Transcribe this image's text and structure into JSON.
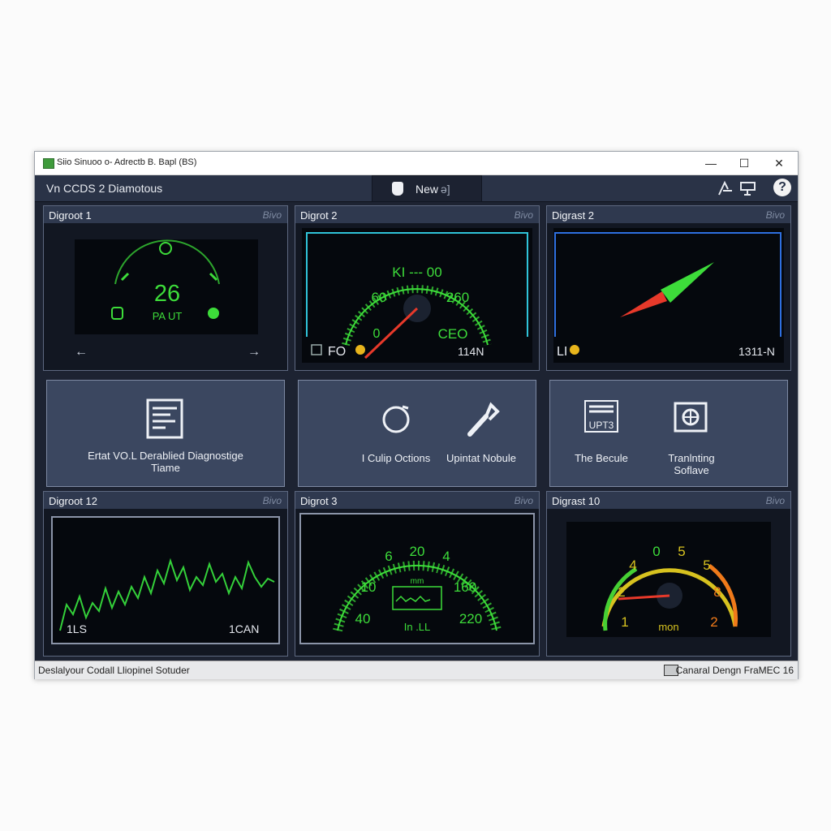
{
  "window": {
    "title": "Siio Sinuoo o- Adrectb B. Bapl (BS)",
    "controls": {
      "minimize": "—",
      "maximize": "☐",
      "close": "✕"
    }
  },
  "toolbar": {
    "app_name": "Vn CCDS 2 Diamotous",
    "new_label": "New",
    "new_suffix": "ə]",
    "help_label": "?"
  },
  "panels": [
    {
      "title": "Digroot 1",
      "tag": "Bivo",
      "readout": "26",
      "mode": "PA UT",
      "left_nav": "←",
      "right_nav": "→"
    },
    {
      "title": "Digrot 2",
      "tag": "Bivo",
      "label_top": "KI --- 00",
      "label_left": "60",
      "label_right": "260",
      "label_min": "0",
      "label_br": "CEO",
      "label_bl": "FO",
      "speed": "114N"
    },
    {
      "title": "Digrast 2",
      "tag": "Bivo",
      "indicator": "LI",
      "value": "1311-N"
    },
    {
      "title": "Digroot 12",
      "tag": "Bivo",
      "left_label": "1LS",
      "right_label": "1CAN"
    },
    {
      "title": "Digrot 3",
      "tag": "Bivo",
      "ticks": [
        "6",
        "20",
        "4",
        "10",
        "160",
        "40",
        "220"
      ],
      "unit": "mm",
      "bottom": "In .LL"
    },
    {
      "title": "Digrast 10",
      "tag": "Bivo",
      "ticks": [
        "0",
        "4",
        "5",
        "5",
        "2",
        "8",
        "1",
        "2"
      ],
      "unit": "mon"
    }
  ],
  "tiles": [
    {
      "label": "Ertat VO.L Derablied Diagnostige Tiame"
    },
    {
      "label": "I Culip Octions"
    },
    {
      "label": "Upintat Nobule"
    },
    {
      "label": "The Becule",
      "icon_text": "UPT3"
    },
    {
      "label": "Tranlnting Soflave"
    }
  ],
  "status": {
    "left": "Deslalyour Codall Lliopinel Sotuder",
    "right": "Canaral Dengn FraMEC 16"
  },
  "colors": {
    "accent_green": "#3ddc3a",
    "needle_red": "#e7392a",
    "frame_cyan": "#2fc3d8",
    "frame_blue": "#2e6fe0"
  }
}
